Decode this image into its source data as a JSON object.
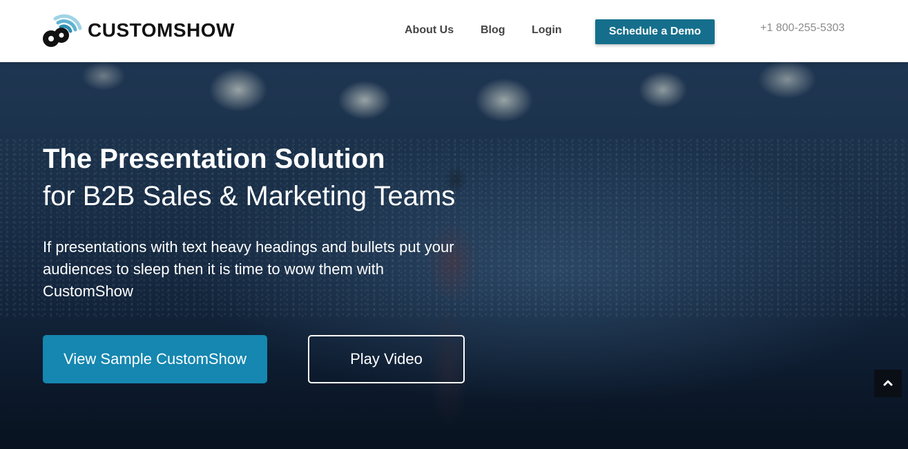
{
  "header": {
    "brand": "CUSTOMSHOW",
    "nav": {
      "about": "About Us",
      "blog": "Blog",
      "login": "Login"
    },
    "demo_button": "Schedule a Demo",
    "phone": "+1 800-255-5303"
  },
  "hero": {
    "title": "The Presentation Solution",
    "subtitle": "for B2B Sales & Marketing Teams",
    "description": "If presentations with text heavy headings and bullets put your audiences to sleep then it is time to wow them with CustomShow",
    "primary_button": "View Sample CustomShow",
    "secondary_button": "Play Video"
  },
  "icons": {
    "logo": "customshow-logo-icon",
    "scroll_top": "chevron-up-icon"
  },
  "colors": {
    "accent": "#156f8c",
    "primary_button": "#1587b0",
    "header_bg": "#ffffff",
    "hero_bg": "#152840"
  }
}
